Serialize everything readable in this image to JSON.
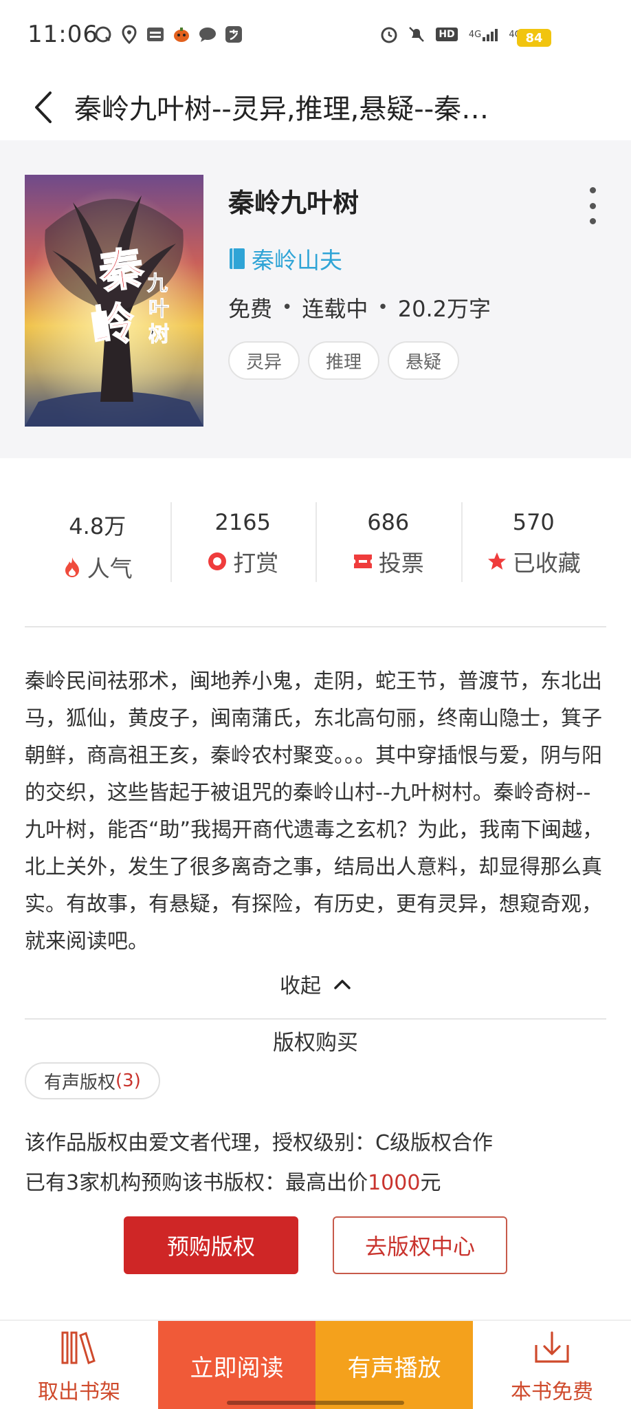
{
  "status_bar": {
    "time": "11:06",
    "battery": "84",
    "left_icons": [
      "qq-icon",
      "location-icon",
      "toutiao-icon",
      "halloween-icon",
      "message-icon",
      "alipay-icon"
    ],
    "right_icons": [
      "alarm-icon",
      "mute-icon",
      "hd-icon",
      "signal-4g-icon",
      "signal-4g-plus-icon"
    ],
    "hd_label": "HD",
    "net1": "4G",
    "net2": "4G+"
  },
  "header": {
    "title": "秦岭九叶树--灵异,推理,悬疑--秦…"
  },
  "book": {
    "title": "秦岭九叶树",
    "author": "秦岭山夫",
    "meta": [
      "免费",
      "连载中",
      "20.2万字"
    ],
    "meta_separator": "•",
    "tags": [
      "灵异",
      "推理",
      "悬疑"
    ],
    "cover_text_big": "秦岭",
    "cover_text_small": "九叶树"
  },
  "stats": [
    {
      "value": "4.8万",
      "label": "人气",
      "icon": "fire-icon"
    },
    {
      "value": "2165",
      "label": "打赏",
      "icon": "reward-icon"
    },
    {
      "value": "686",
      "label": "投票",
      "icon": "ticket-icon"
    },
    {
      "value": "570",
      "label": "已收藏",
      "icon": "star-icon"
    }
  ],
  "description": "秦岭民间祛邪术，闽地养小鬼，走阴，蛇王节，普渡节，东北出马，狐仙，黄皮子，闽南蒲氏，东北高句丽，终南山隐士，箕子朝鲜，商高祖王亥，秦岭农村聚变。。。其中穿插恨与爱，阴与阳的交织，这些皆起于被诅咒的秦岭山村--九叶树村。秦岭奇树--九叶树，能否“助”我揭开商代遗毒之玄机？为此，我南下闽越，北上关外，发生了很多离奇之事，结局出人意料，却显得那么真实。有故事，有悬疑，有探险，有历史，更有灵异，想窥奇观，就来阅读吧。",
  "collapse_label": "收起",
  "copyright": {
    "title": "版权购买",
    "audio_label": "有声版权",
    "audio_count": "(3)",
    "line1": "该作品版权由爱文者代理，授权级别：C级版权合作",
    "line2_prefix": "已有3家机构预购该书版权：最高出价",
    "line2_price": "1000",
    "line2_suffix": "元",
    "preorder_button": "预购版权",
    "center_button": "去版权中心"
  },
  "bottom_bar": {
    "shelf_label": "取出书架",
    "read_label": "立即阅读",
    "audio_label": "有声播放",
    "free_label": "本书免费"
  },
  "colors": {
    "accent_red": "#cf2626",
    "author_blue": "#2fa4d6",
    "read_orange": "#f05a38",
    "audio_amber": "#f4a11c",
    "bottom_label": "#cf4a2c"
  }
}
